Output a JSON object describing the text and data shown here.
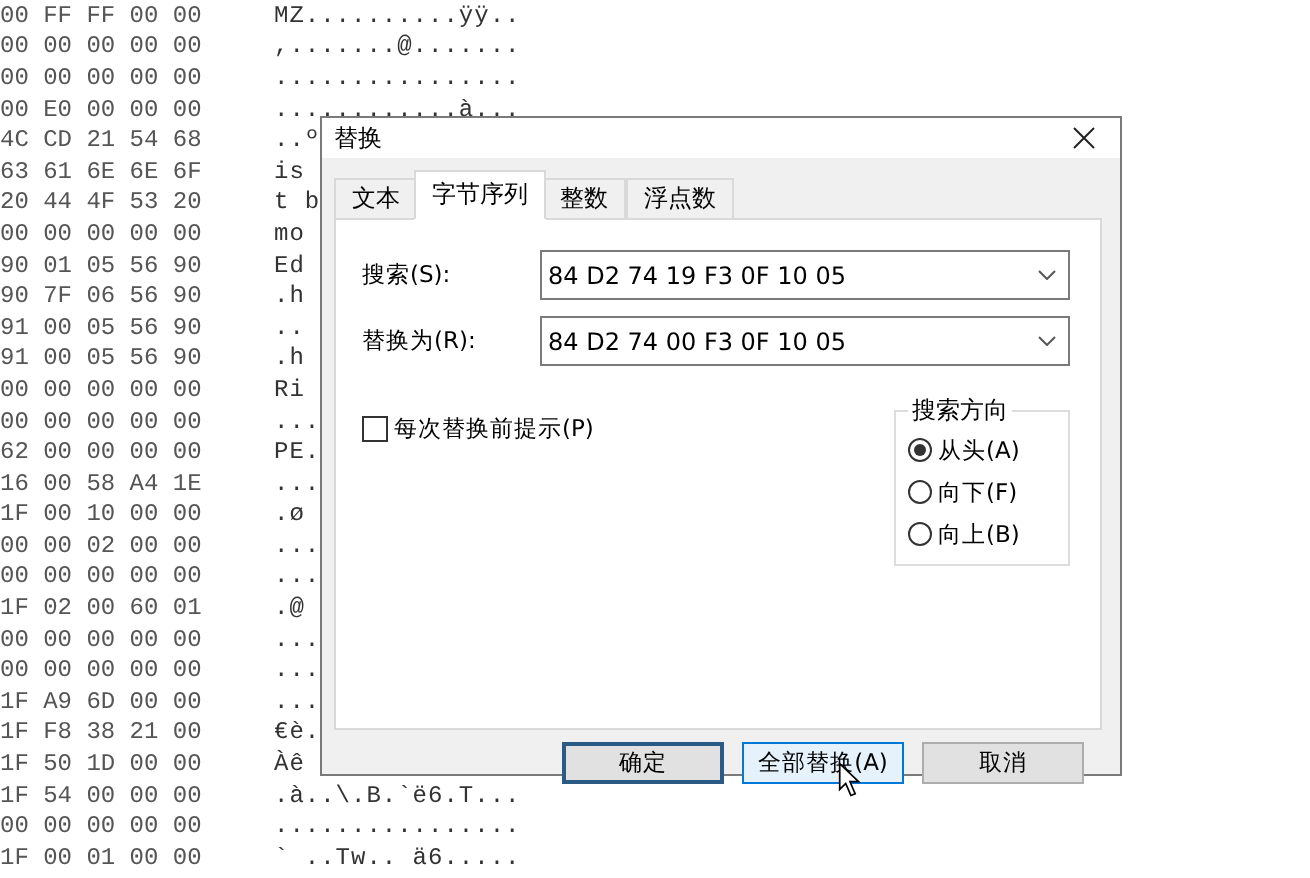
{
  "hex_rows": [
    {
      "bytes": "00 FF FF 00 00",
      "text": "MZ..........ÿÿ.."
    },
    {
      "bytes": "00 00 00 00 00",
      "text": ",.......@......."
    },
    {
      "bytes": "00 00 00 00 00",
      "text": "................"
    },
    {
      "bytes": "00 E0 00 00 00",
      "text": "............à..."
    },
    {
      "bytes": "4C CD 21 54 68",
      "text": "..º"
    },
    {
      "bytes": "63 61 6E 6E 6F",
      "text": "is"
    },
    {
      "bytes": "20 44 4F 53 20",
      "text": "t b"
    },
    {
      "bytes": "00 00 00 00 00",
      "text": "mo"
    },
    {
      "bytes": "90 01 05 56 90",
      "text": "Ed"
    },
    {
      "bytes": "90 7F 06 56 90",
      "text": ".h"
    },
    {
      "bytes": "91 00 05 56 90",
      "text": ".."
    },
    {
      "bytes": "91 00 05 56 90",
      "text": ".h"
    },
    {
      "bytes": "00 00 00 00 00",
      "text": "Ri"
    },
    {
      "bytes": "00 00 00 00 00",
      "text": "..."
    },
    {
      "bytes": "62 00 00 00 00",
      "text": "PE."
    },
    {
      "bytes": "16 00 58 A4 1E",
      "text": "..."
    },
    {
      "bytes": "1F 00 10 00 00",
      "text": ".ø"
    },
    {
      "bytes": "00 00 02 00 00",
      "text": "..."
    },
    {
      "bytes": "00 00 00 00 00",
      "text": "..."
    },
    {
      "bytes": "1F 02 00 60 01",
      "text": ".@"
    },
    {
      "bytes": "00 00 00 00 00",
      "text": "..."
    },
    {
      "bytes": "00 00 00 00 00",
      "text": "..."
    },
    {
      "bytes": "1F A9 6D 00 00",
      "text": "..."
    },
    {
      "bytes": "1F F8 38 21 00",
      "text": "€è."
    },
    {
      "bytes": "1F 50 1D 00 00",
      "text": "Àê"
    },
    {
      "bytes": "1F 54 00 00 00",
      "text": ".à..\\.B.`ë6.T..."
    },
    {
      "bytes": "00 00 00 00 00",
      "text": "................"
    },
    {
      "bytes": "1F 00 01 00 00",
      "text": "` ..Tw.. ä6....."
    }
  ],
  "dialog": {
    "title": "替换",
    "tabs": [
      {
        "label": "文本",
        "selected": false
      },
      {
        "label": "字节序列",
        "selected": true
      },
      {
        "label": "整数",
        "selected": false
      },
      {
        "label": "浮点数",
        "selected": false
      }
    ],
    "search": {
      "label": "搜索(S):",
      "value": "84 D2 74 19 F3 0F 10 05"
    },
    "replace": {
      "label": "替换为(R):",
      "value": "84 D2 74 00 F3 0F 10 05"
    },
    "prompt_checkbox": {
      "label": "每次替换前提示(P)",
      "checked": false
    },
    "direction": {
      "title": "搜索方向",
      "options": [
        {
          "label": "从头(A)",
          "selected": true
        },
        {
          "label": "向下(F)",
          "selected": false
        },
        {
          "label": "向上(B)",
          "selected": false
        }
      ]
    },
    "buttons": [
      {
        "label": "确定",
        "default": true,
        "hovered": false
      },
      {
        "label": "全部替换(A)",
        "default": false,
        "hovered": true
      },
      {
        "label": "取消",
        "default": false,
        "hovered": false
      }
    ]
  }
}
